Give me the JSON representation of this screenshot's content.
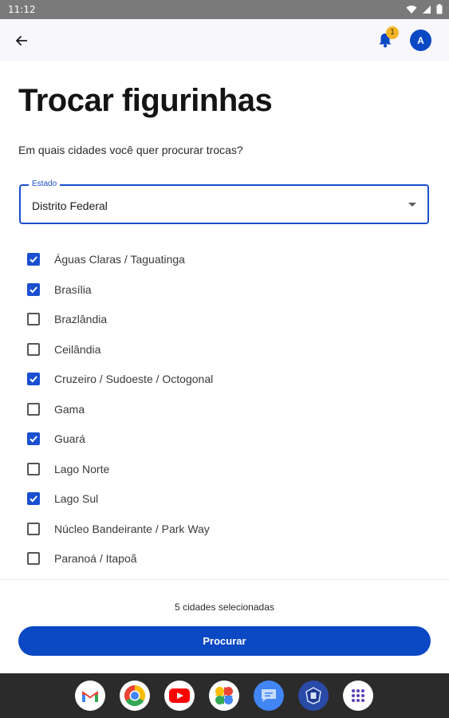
{
  "status_bar": {
    "time": "11:12"
  },
  "app_bar": {
    "notification_count": "1",
    "avatar_initial": "A"
  },
  "page": {
    "title": "Trocar figurinhas",
    "subtitle": "Em quais cidades você quer procurar trocas?"
  },
  "state_select": {
    "label": "Estado",
    "value": "Distrito Federal"
  },
  "cities": [
    {
      "name": "Águas Claras / Taguatinga",
      "checked": true
    },
    {
      "name": "Brasília",
      "checked": true
    },
    {
      "name": "Brazlândia",
      "checked": false
    },
    {
      "name": "Ceilândia",
      "checked": false
    },
    {
      "name": "Cruzeiro / Sudoeste / Octogonal",
      "checked": true
    },
    {
      "name": "Gama",
      "checked": false
    },
    {
      "name": "Guará",
      "checked": true
    },
    {
      "name": "Lago Norte",
      "checked": false
    },
    {
      "name": "Lago Sul",
      "checked": true
    },
    {
      "name": "Núcleo Bandeirante / Park Way",
      "checked": false
    },
    {
      "name": "Paranoá / Itapoã",
      "checked": false
    }
  ],
  "footer": {
    "selected_count_text": "5 cidades selecionadas",
    "search_button": "Procurar"
  },
  "dock": {
    "apps": [
      "gmail-icon",
      "chrome-icon",
      "youtube-icon",
      "photos-icon",
      "messages-icon",
      "sticker-app-icon",
      "app-drawer-icon"
    ]
  },
  "colors": {
    "primary": "#0a48c4",
    "badge": "#f5b524",
    "nav_bar": "#2b2b2b"
  }
}
